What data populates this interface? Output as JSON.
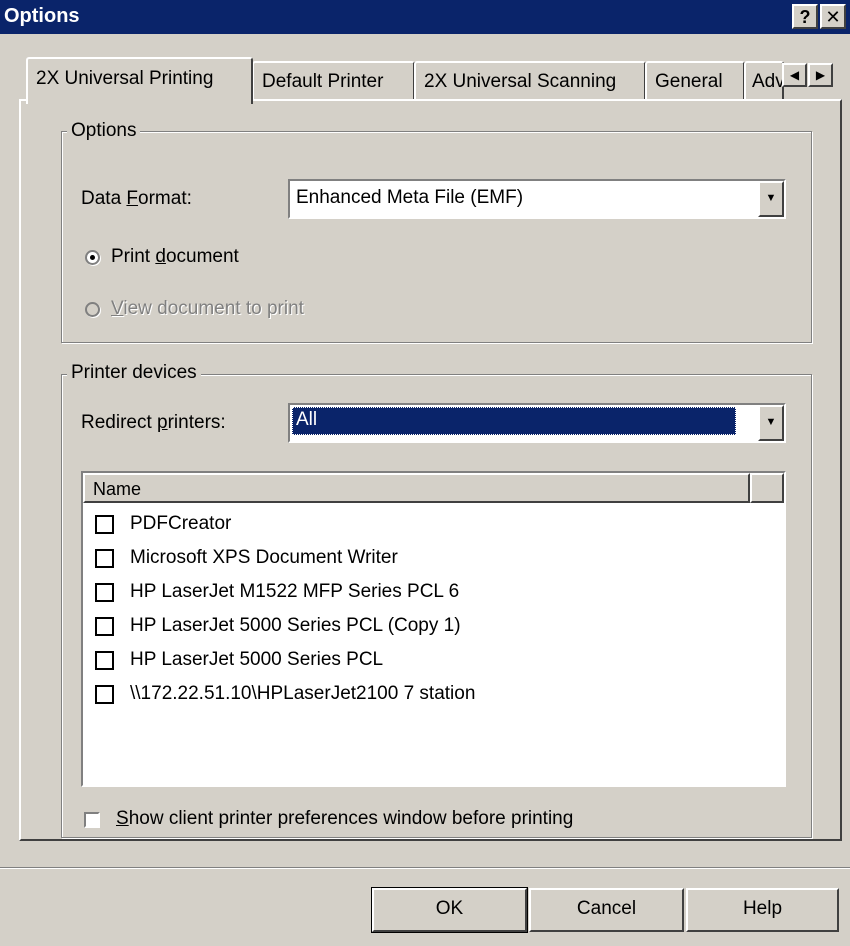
{
  "window": {
    "title": "Options",
    "help_glyph": "?",
    "close_glyph": "✕"
  },
  "tabs": [
    {
      "label": "2X Universal Printing",
      "active": true
    },
    {
      "label": "Default Printer",
      "active": false
    },
    {
      "label": "2X Universal Scanning",
      "active": false
    },
    {
      "label": "General",
      "active": false
    },
    {
      "label": "Advanced",
      "active": false
    }
  ],
  "tab_scroll": {
    "left_glyph": "◀",
    "right_glyph": "▶"
  },
  "options_group": {
    "legend": "Options",
    "data_format_label_pre": "Data ",
    "data_format_label_u": "F",
    "data_format_label_post": "ormat:",
    "data_format_value": "Enhanced Meta File (EMF)",
    "print_document_pre": "Print ",
    "print_document_u": "d",
    "print_document_post": "ocument",
    "print_document_selected": true,
    "view_document_u": "V",
    "view_document_post": "iew document to print",
    "view_document_enabled": false
  },
  "printer_group": {
    "legend": "Printer devices",
    "redirect_label_pre": "Redirect ",
    "redirect_label_u": "p",
    "redirect_label_post": "rinters:",
    "redirect_value": "All",
    "column_name": "Name",
    "printers": [
      {
        "name": "PDFCreator",
        "checked": false
      },
      {
        "name": "Microsoft XPS Document Writer",
        "checked": false
      },
      {
        "name": "HP LaserJet M1522 MFP Series PCL 6",
        "checked": false
      },
      {
        "name": "HP LaserJet 5000 Series PCL (Copy 1)",
        "checked": false
      },
      {
        "name": "HP LaserJet 5000 Series PCL",
        "checked": false
      },
      {
        "name": "\\\\172.22.51.10\\HPLaserJet2100 7 station",
        "checked": false
      }
    ],
    "show_prefs_u": "S",
    "show_prefs_post": "how client printer preferences window before printing",
    "show_prefs_checked": false
  },
  "buttons": {
    "ok": "OK",
    "cancel": "Cancel",
    "help": "Help"
  },
  "combo_arrow": "▼"
}
